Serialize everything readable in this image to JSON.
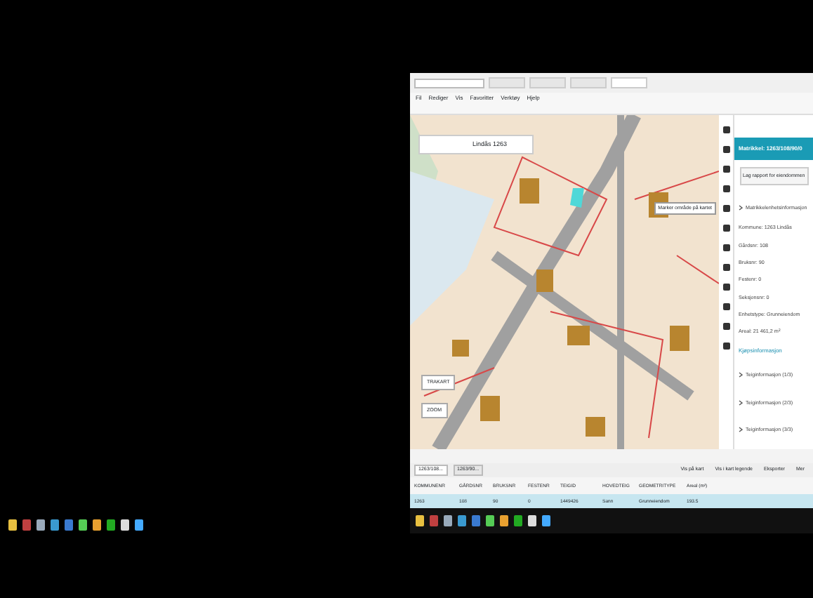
{
  "browser": {
    "menu": [
      "Fil",
      "Rediger",
      "Vis",
      "Favoritter",
      "Verktøy",
      "Hjelp"
    ],
    "tabs": [
      {
        "selected": false
      },
      {
        "selected": false
      },
      {
        "selected": false
      },
      {
        "selected": true
      }
    ],
    "search": {
      "value": "Lindås 1263"
    },
    "tooltip": "Marker område på kartet",
    "map_buttons": [
      "TRAKART",
      "ZOOM"
    ],
    "panel": {
      "title": "Matrikkel: 1263/108/90/0",
      "button": "Lag rapport for eiendommen",
      "items": [
        {
          "kind": "heading",
          "text": "Matrikkelenhetsinformasjon"
        },
        {
          "kind": "field",
          "text": "Kommune: 1263 Lindås"
        },
        {
          "kind": "field",
          "text": "Gårdsnr: 108"
        },
        {
          "kind": "field",
          "text": "Bruksnr: 90"
        },
        {
          "kind": "field",
          "text": "Festenr: 0"
        },
        {
          "kind": "field",
          "text": "Seksjonsnr: 0"
        },
        {
          "kind": "field",
          "text": "Enhetstype: Grunneiendom"
        },
        {
          "kind": "field",
          "text": "Areal: 21 461,2 m$^{2}$"
        },
        {
          "kind": "link",
          "text": "Kjøpsinformasjon"
        },
        {
          "kind": "heading",
          "text": "Teiginformasjon (1/3)"
        },
        {
          "kind": "heading",
          "text": "Teiginformasjon (2/3)"
        },
        {
          "kind": "heading",
          "text": "Teiginformasjon (3/3)"
        }
      ]
    },
    "table": {
      "tabs": [
        {
          "label": "1263/108...",
          "selected": true
        },
        {
          "label": "1263/90...",
          "selected": false
        }
      ],
      "tools": [
        "Vis på kart",
        "Vis i kart legende",
        "Eksporter",
        "Mer"
      ],
      "columns": [
        "KOMMUNENR",
        "GÅRDSNR",
        "BRUKSNR",
        "FESTENR",
        "TEIGID",
        "HOVEDTEIG",
        "GEOMETRITYPE",
        "Areal (m²)"
      ],
      "rows": [
        {
          "selected": true,
          "cells": [
            "1263",
            "108",
            "90",
            "0",
            "1449426",
            "Sann",
            "Grunneiendom",
            "193.5"
          ]
        }
      ]
    }
  }
}
